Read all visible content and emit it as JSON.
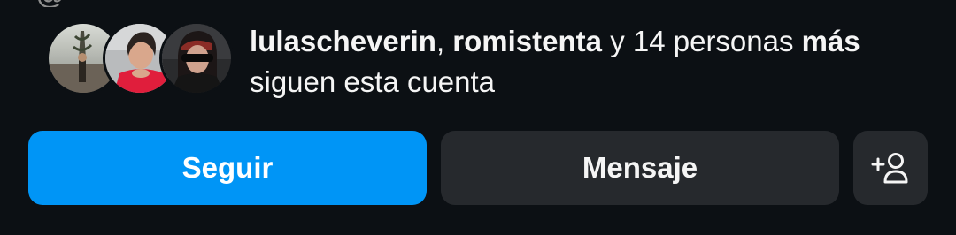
{
  "profile_header": {
    "cropped_top_text": "@"
  },
  "followed_by": {
    "user_1": "lulascheverin",
    "separator": ",",
    "user_2": "romistenta",
    "connector": "y",
    "others_count_text": "14 personas",
    "others_more_text": "más",
    "suffix": "siguen esta cuenta"
  },
  "actions": {
    "follow_label": "Seguir",
    "message_label": "Mensaje",
    "suggest_icon": "add-person-icon"
  },
  "colors": {
    "background": "#0c1014",
    "follow_button": "#0095f6",
    "secondary_button": "#26292d",
    "text": "#f5f5f5"
  }
}
